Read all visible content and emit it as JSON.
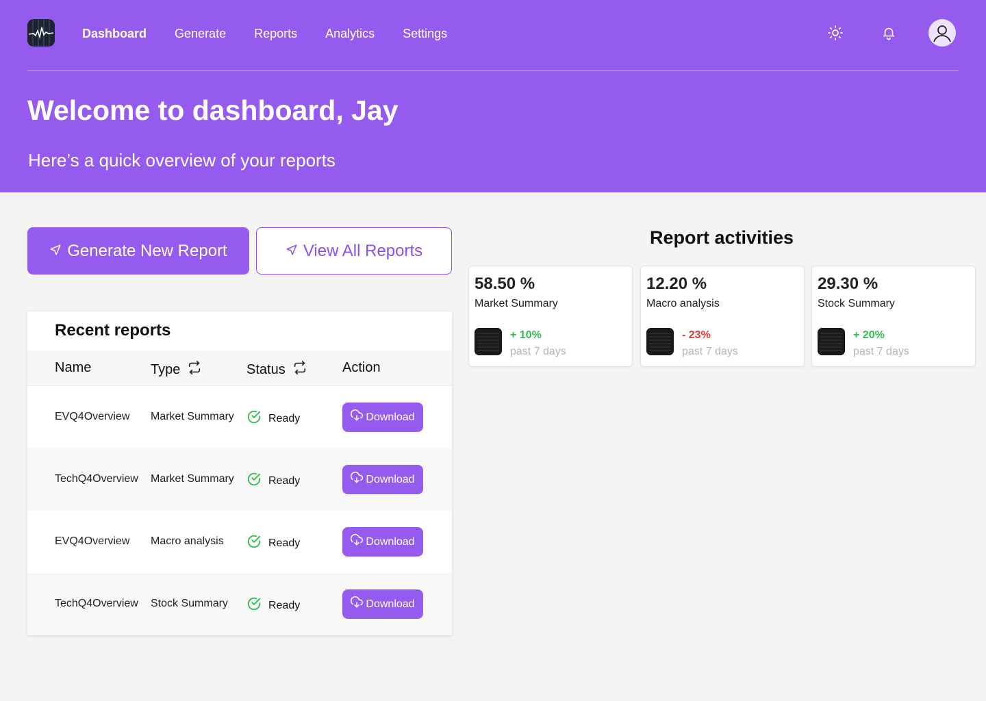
{
  "nav": {
    "items": [
      {
        "label": "Dashboard",
        "active": true
      },
      {
        "label": "Generate",
        "active": false
      },
      {
        "label": "Reports",
        "active": false
      },
      {
        "label": "Analytics",
        "active": false
      },
      {
        "label": "Settings",
        "active": false
      }
    ],
    "icons": [
      "sun-icon",
      "bell-icon",
      "user-avatar-icon"
    ]
  },
  "hero": {
    "title": "Welcome to dashboard, Jay",
    "subtitle": "Here’s a quick overview of your reports"
  },
  "actions": {
    "generate_label": "Generate New Report",
    "view_all_label": "View All Reports"
  },
  "recent": {
    "title": "Recent reports",
    "columns": [
      "Name",
      "Type",
      "Status",
      "Action"
    ],
    "rows": [
      {
        "name": "EVQ4Overview",
        "type": "Market Summary",
        "status": "Ready",
        "action": "Download"
      },
      {
        "name": "TechQ4Overview",
        "type": "Market Summary",
        "status": "Ready",
        "action": "Download"
      },
      {
        "name": "EVQ4Overview",
        "type": "Macro analysis",
        "status": "Ready",
        "action": "Download"
      },
      {
        "name": "TechQ4Overview",
        "type": "Stock Summary",
        "status": "Ready",
        "action": "Download"
      }
    ]
  },
  "activities": {
    "title": "Report activities",
    "cards": [
      {
        "percent": "58.50 %",
        "name": "Market Summary",
        "change": "+ 10%",
        "period": "past 7 days",
        "trend": "up"
      },
      {
        "percent": "12.20 %",
        "name": "Macro analysis",
        "change": "- 23%",
        "period": "past 7 days",
        "trend": "down"
      },
      {
        "percent": "29.30 %",
        "name": "Stock Summary",
        "change": "+ 20%",
        "period": "past 7 days",
        "trend": "up"
      }
    ]
  },
  "colors": {
    "brand": "#955bee",
    "positive": "#2fbd52",
    "negative": "#e53935",
    "muted": "#b5b5b5"
  }
}
